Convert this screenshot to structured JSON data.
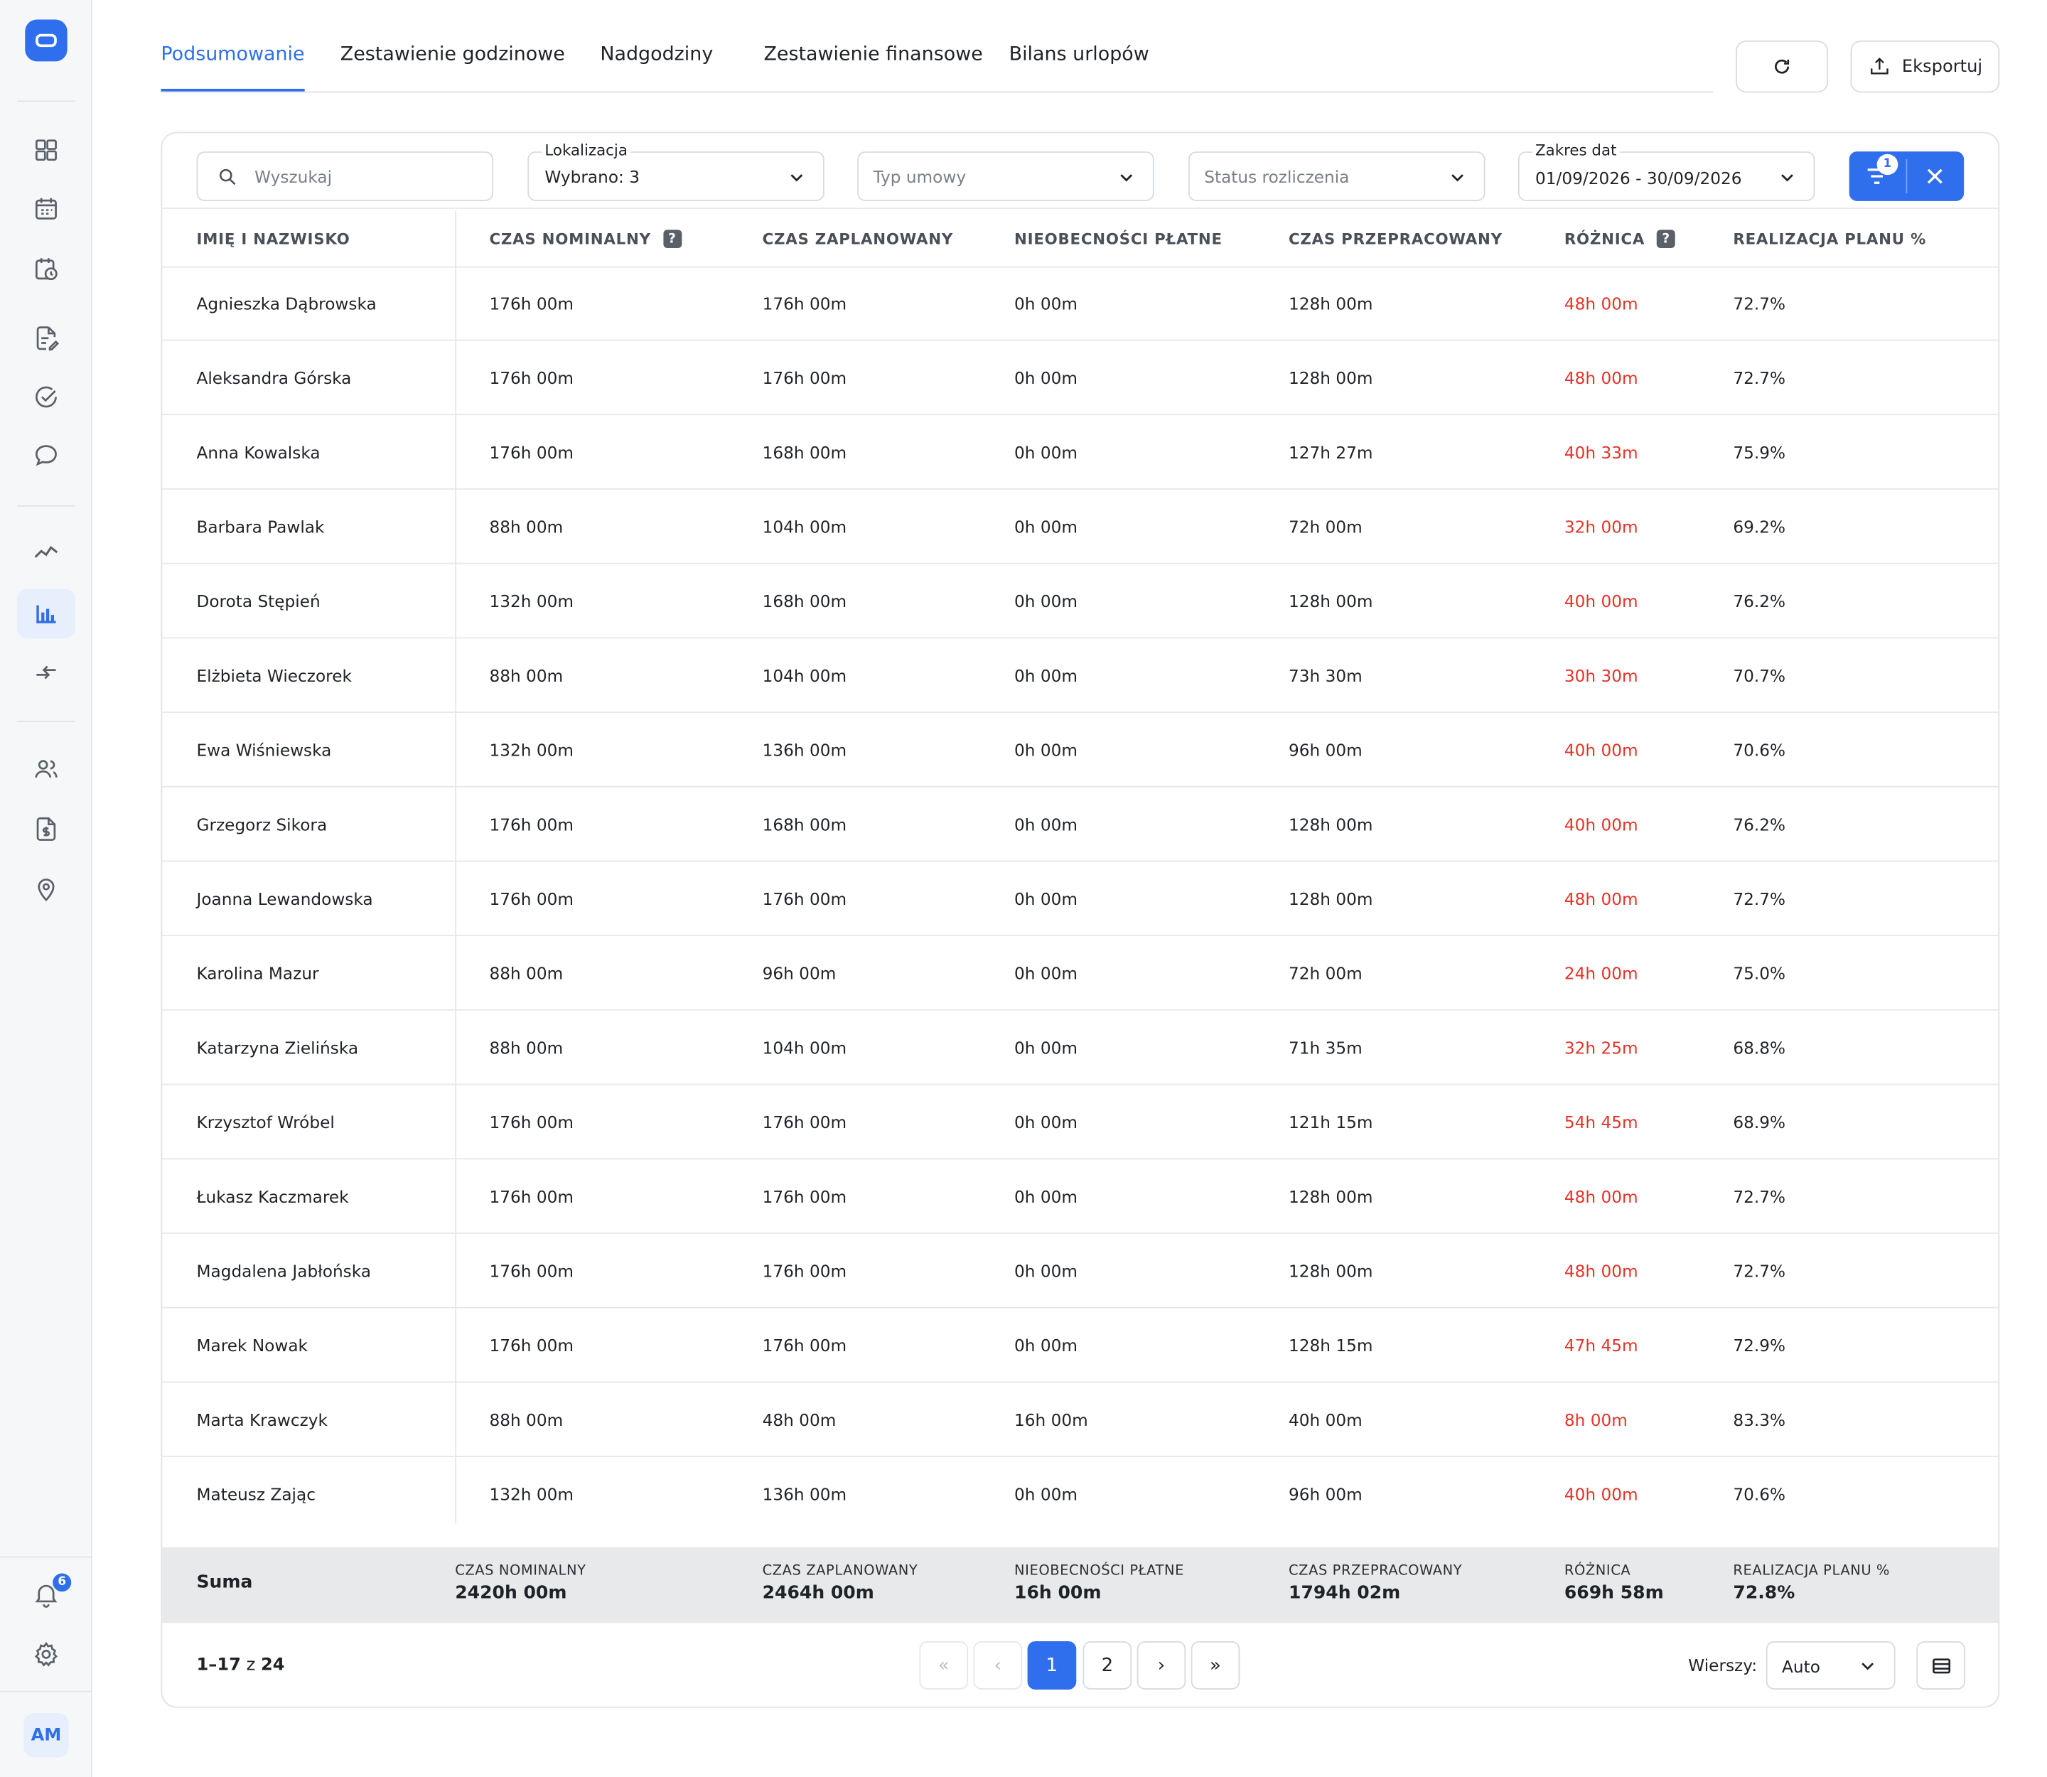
{
  "tabs": [
    "Podsumowanie",
    "Zestawienie godzinowe",
    "Nadgodziny",
    "Zestawienie finansowe",
    "Bilans urlopów"
  ],
  "active_tab": "Podsumowanie",
  "actions": {
    "export_label": "Eksportuj",
    "refresh_icon": "refresh-icon"
  },
  "filters": {
    "search_placeholder": "Wyszukaj",
    "location_label": "Lokalizacja",
    "location_value": "Wybrano: 3",
    "contract_placeholder": "Typ umowy",
    "settlement_placeholder": "Status rozliczenia",
    "date_label": "Zakres dat",
    "date_value": "01/09/2026 - 30/09/2026",
    "active_filter_count": "1"
  },
  "columns": [
    "IMIĘ I NAZWISKO",
    "CZAS NOMINALNY",
    "CZAS ZAPLANOWANY",
    "NIEOBECNOŚCI PŁATNE",
    "CZAS PRZEPRACOWANY",
    "RÓŻNICA",
    "REALIZACJA PLANU %"
  ],
  "help_mark": "?",
  "rows": [
    [
      "Agnieszka Dąbrowska",
      "176h 00m",
      "176h 00m",
      "0h 00m",
      "128h 00m",
      "48h 00m",
      "72.7%"
    ],
    [
      "Aleksandra Górska",
      "176h 00m",
      "176h 00m",
      "0h 00m",
      "128h 00m",
      "48h 00m",
      "72.7%"
    ],
    [
      "Anna Kowalska",
      "176h 00m",
      "168h 00m",
      "0h 00m",
      "127h 27m",
      "40h 33m",
      "75.9%"
    ],
    [
      "Barbara Pawlak",
      "88h 00m",
      "104h 00m",
      "0h 00m",
      "72h 00m",
      "32h 00m",
      "69.2%"
    ],
    [
      "Dorota Stępień",
      "132h 00m",
      "168h 00m",
      "0h 00m",
      "128h 00m",
      "40h 00m",
      "76.2%"
    ],
    [
      "Elżbieta Wieczorek",
      "88h 00m",
      "104h 00m",
      "0h 00m",
      "73h 30m",
      "30h 30m",
      "70.7%"
    ],
    [
      "Ewa Wiśniewska",
      "132h 00m",
      "136h 00m",
      "0h 00m",
      "96h 00m",
      "40h 00m",
      "70.6%"
    ],
    [
      "Grzegorz Sikora",
      "176h 00m",
      "168h 00m",
      "0h 00m",
      "128h 00m",
      "40h 00m",
      "76.2%"
    ],
    [
      "Joanna Lewandowska",
      "176h 00m",
      "176h 00m",
      "0h 00m",
      "128h 00m",
      "48h 00m",
      "72.7%"
    ],
    [
      "Karolina Mazur",
      "88h 00m",
      "96h 00m",
      "0h 00m",
      "72h 00m",
      "24h 00m",
      "75.0%"
    ],
    [
      "Katarzyna Zielińska",
      "88h 00m",
      "104h 00m",
      "0h 00m",
      "71h 35m",
      "32h 25m",
      "68.8%"
    ],
    [
      "Krzysztof Wróbel",
      "176h 00m",
      "176h 00m",
      "0h 00m",
      "121h 15m",
      "54h 45m",
      "68.9%"
    ],
    [
      "Łukasz Kaczmarek",
      "176h 00m",
      "176h 00m",
      "0h 00m",
      "128h 00m",
      "48h 00m",
      "72.7%"
    ],
    [
      "Magdalena Jabłońska",
      "176h 00m",
      "176h 00m",
      "0h 00m",
      "128h 00m",
      "48h 00m",
      "72.7%"
    ],
    [
      "Marek Nowak",
      "176h 00m",
      "176h 00m",
      "0h 00m",
      "128h 15m",
      "47h 45m",
      "72.9%"
    ],
    [
      "Marta Krawczyk",
      "88h 00m",
      "48h 00m",
      "16h 00m",
      "40h 00m",
      "8h 00m",
      "83.3%"
    ],
    [
      "Mateusz Zając",
      "132h 00m",
      "136h 00m",
      "0h 00m",
      "96h 00m",
      "40h 00m",
      "70.6%"
    ]
  ],
  "summary": {
    "title": "Suma",
    "labels": [
      "CZAS NOMINALNY",
      "CZAS ZAPLANOWANY",
      "NIEOBECNOŚCI PŁATNE",
      "CZAS PRZEPRACOWANY",
      "RÓŻNICA",
      "REALIZACJA PLANU %"
    ],
    "values": [
      "2420h 00m",
      "2464h 00m",
      "16h 00m",
      "1794h 02m",
      "669h 58m",
      "72.8%"
    ]
  },
  "pagination": {
    "range": "1–17",
    "of_label": "z",
    "total": "24",
    "pages": [
      "1",
      "2"
    ],
    "current_page": "1",
    "first": "«",
    "prev": "‹",
    "next": "›",
    "last": "»",
    "rows_label": "Wierszy:",
    "rows_value": "Auto"
  },
  "sidebar": {
    "notification_count": "6",
    "user_initials": "AM"
  },
  "colors": {
    "accent": "#2f6fed",
    "negative": "#e5332a"
  }
}
